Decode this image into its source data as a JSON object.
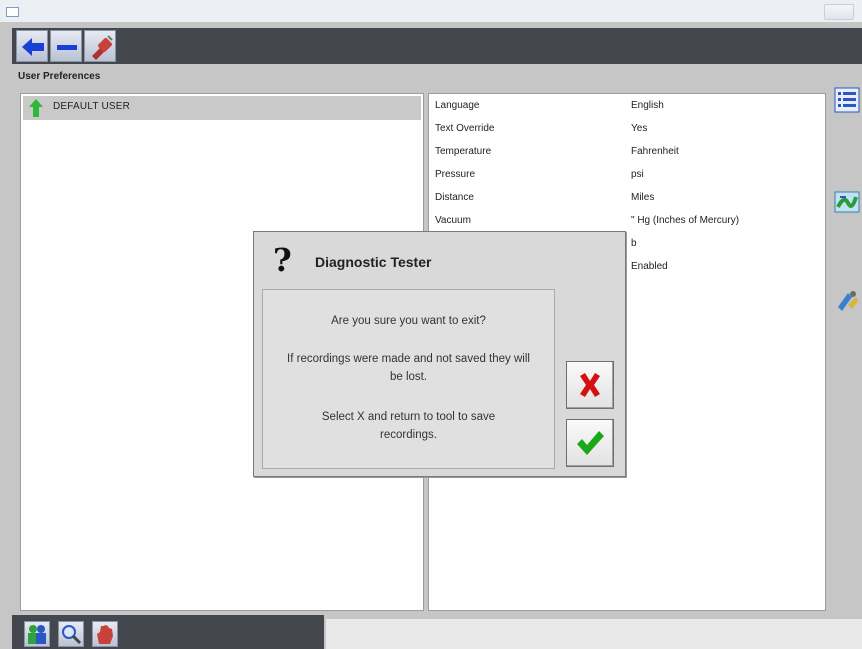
{
  "window": {
    "title": ""
  },
  "toolbar": {
    "buttons": [
      {
        "icon": "back-arrow-icon"
      },
      {
        "icon": "minus-icon"
      },
      {
        "icon": "cable-connector-icon"
      }
    ]
  },
  "section_title": "User Preferences",
  "users": [
    {
      "label": "DEFAULT USER",
      "icon": "up-arrow-icon"
    }
  ],
  "preferences": [
    {
      "key": "Language",
      "value": "English"
    },
    {
      "key": "Text Override",
      "value": "Yes"
    },
    {
      "key": "Temperature",
      "value": "Fahrenheit"
    },
    {
      "key": "Pressure",
      "value": "psi"
    },
    {
      "key": "Distance",
      "value": "Miles"
    },
    {
      "key": "Vacuum",
      "value": "\" Hg (Inches of Mercury)"
    },
    {
      "key": "",
      "value": "b"
    },
    {
      "key": "",
      "value": "Enabled"
    }
  ],
  "side_tools": [
    {
      "icon": "list-icon"
    },
    {
      "icon": "map-icon"
    },
    {
      "icon": "tools-icon"
    }
  ],
  "bottom_tools": [
    {
      "icon": "people-icon"
    },
    {
      "icon": "magnifier-icon"
    },
    {
      "icon": "hand-icon"
    }
  ],
  "dialog": {
    "title": "Diagnostic Tester",
    "icon": "question-mark-icon",
    "question_mark": "?",
    "line1": "Are you sure you want to exit?",
    "line2": "If recordings were made and not saved they will be lost.",
    "line3": "Select X and return to tool to save recordings.",
    "cancel_icon": "red-x-icon",
    "confirm_icon": "green-check-icon"
  },
  "colors": {
    "toolbar_dark": "#45474e",
    "panel_gray": "#c6c6c6",
    "accent_blue": "#1a3fd6",
    "cancel_red": "#d41010",
    "confirm_green": "#18a818"
  }
}
